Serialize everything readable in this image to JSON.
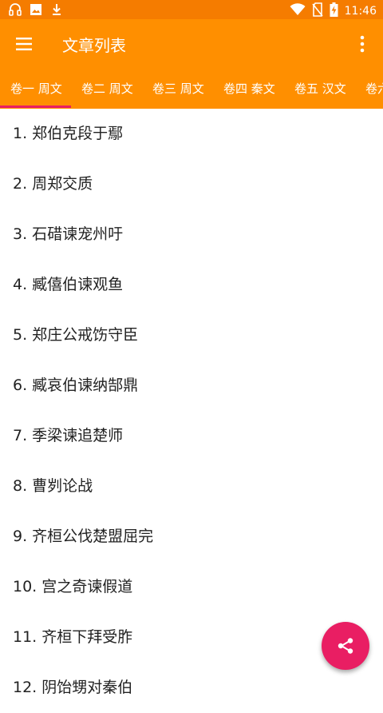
{
  "status_bar": {
    "time": "11:46",
    "icons": [
      "headset-icon",
      "image-icon",
      "download-icon",
      "wifi-icon",
      "no-sim-icon",
      "battery-charging-icon"
    ]
  },
  "toolbar": {
    "title": "文章列表",
    "menu_icon": "hamburger-menu-icon",
    "more_icon": "more-vert-icon"
  },
  "tabs": [
    {
      "label": "卷一 周文",
      "selected": true
    },
    {
      "label": "卷二 周文",
      "selected": false
    },
    {
      "label": "卷三 周文",
      "selected": false
    },
    {
      "label": "卷四 秦文",
      "selected": false
    },
    {
      "label": "卷五 汉文",
      "selected": false
    },
    {
      "label": "卷六",
      "selected": false
    }
  ],
  "articles": [
    "1. 郑伯克段于鄢",
    "2. 周郑交质",
    "3. 石碏谏宠州吁",
    "4. 臧僖伯谏观鱼",
    "5. 郑庄公戒饬守臣",
    "6. 臧哀伯谏纳郜鼎",
    "7. 季梁谏追楚师",
    "8. 曹刿论战",
    "9. 齐桓公伐楚盟屈完",
    "10. 宫之奇谏假道",
    "11. 齐桓下拜受胙",
    "12. 阴饴甥对秦伯"
  ],
  "fab": {
    "icon": "share-icon"
  },
  "colors": {
    "status_bar": "#f57c00",
    "primary": "#ff8f00",
    "accent": "#e91e63",
    "text": "#222222"
  }
}
